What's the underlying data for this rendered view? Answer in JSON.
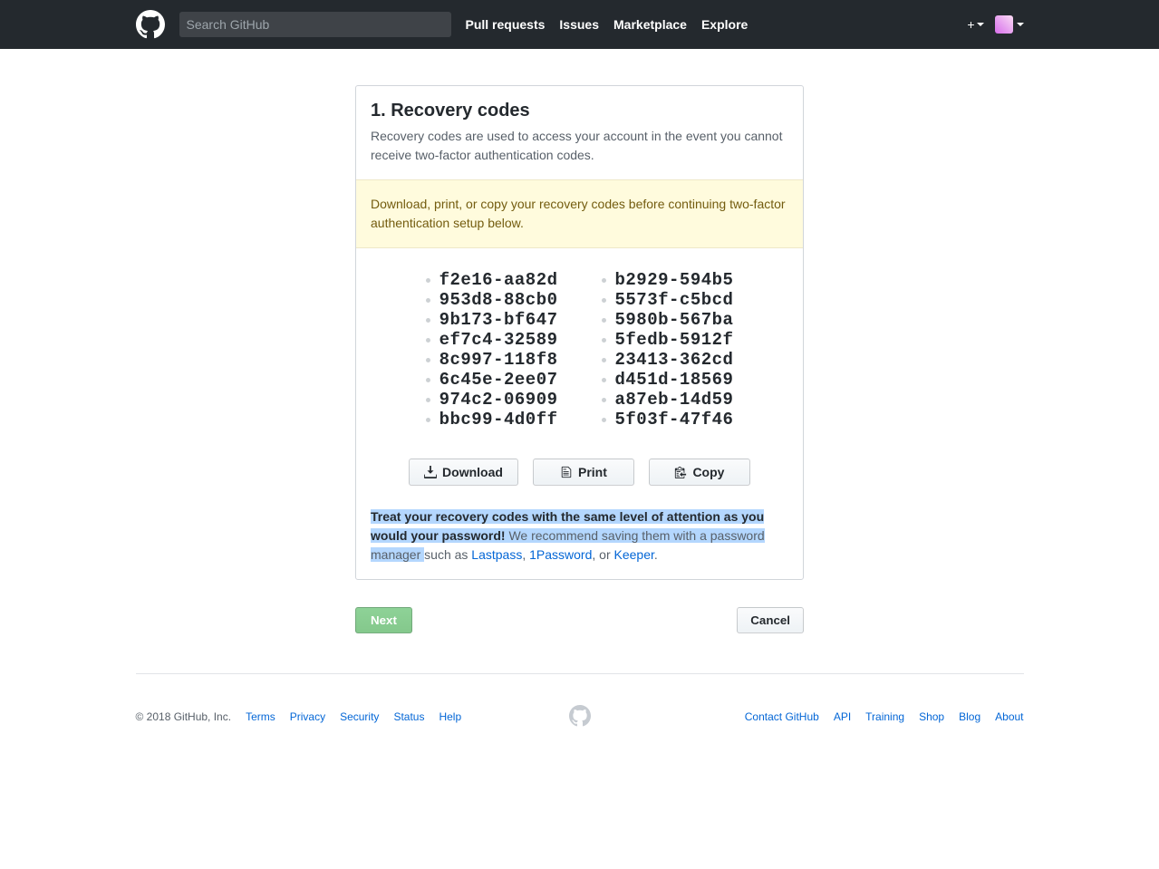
{
  "header": {
    "search_placeholder": "Search GitHub",
    "nav": [
      "Pull requests",
      "Issues",
      "Marketplace",
      "Explore"
    ]
  },
  "card": {
    "title": "1. Recovery codes",
    "subtitle": "Recovery codes are used to access your account in the event you cannot receive two-factor authentication codes.",
    "flash": "Download, print, or copy your recovery codes before continuing two-factor authentication setup below.",
    "codes_left": [
      "f2e16-aa82d",
      "953d8-88cb0",
      "9b173-bf647",
      "ef7c4-32589",
      "8c997-118f8",
      "6c45e-2ee07",
      "974c2-06909",
      "bbc99-4d0ff"
    ],
    "codes_right": [
      "b2929-594b5",
      "5573f-c5bcd",
      "5980b-567ba",
      "5fedb-5912f",
      "23413-362cd",
      "d451d-18569",
      "a87eb-14d59",
      "5f03f-47f46"
    ],
    "download_label": "Download",
    "print_label": "Print",
    "copy_label": "Copy",
    "note_strong": "Treat your recovery codes with the same level of attention as you would your password!",
    "note_mid": " We recommend saving them with a password manager ",
    "note_tail_pre": "such as ",
    "note_link1": "Lastpass",
    "note_sep1": ", ",
    "note_link2": "1Password",
    "note_sep2": ", or ",
    "note_link3": "Keeper",
    "note_period": "."
  },
  "actions": {
    "next": "Next",
    "cancel": "Cancel"
  },
  "footer": {
    "copyright": "© 2018 GitHub, Inc.",
    "left": [
      "Terms",
      "Privacy",
      "Security",
      "Status",
      "Help"
    ],
    "right": [
      "Contact GitHub",
      "API",
      "Training",
      "Shop",
      "Blog",
      "About"
    ]
  }
}
